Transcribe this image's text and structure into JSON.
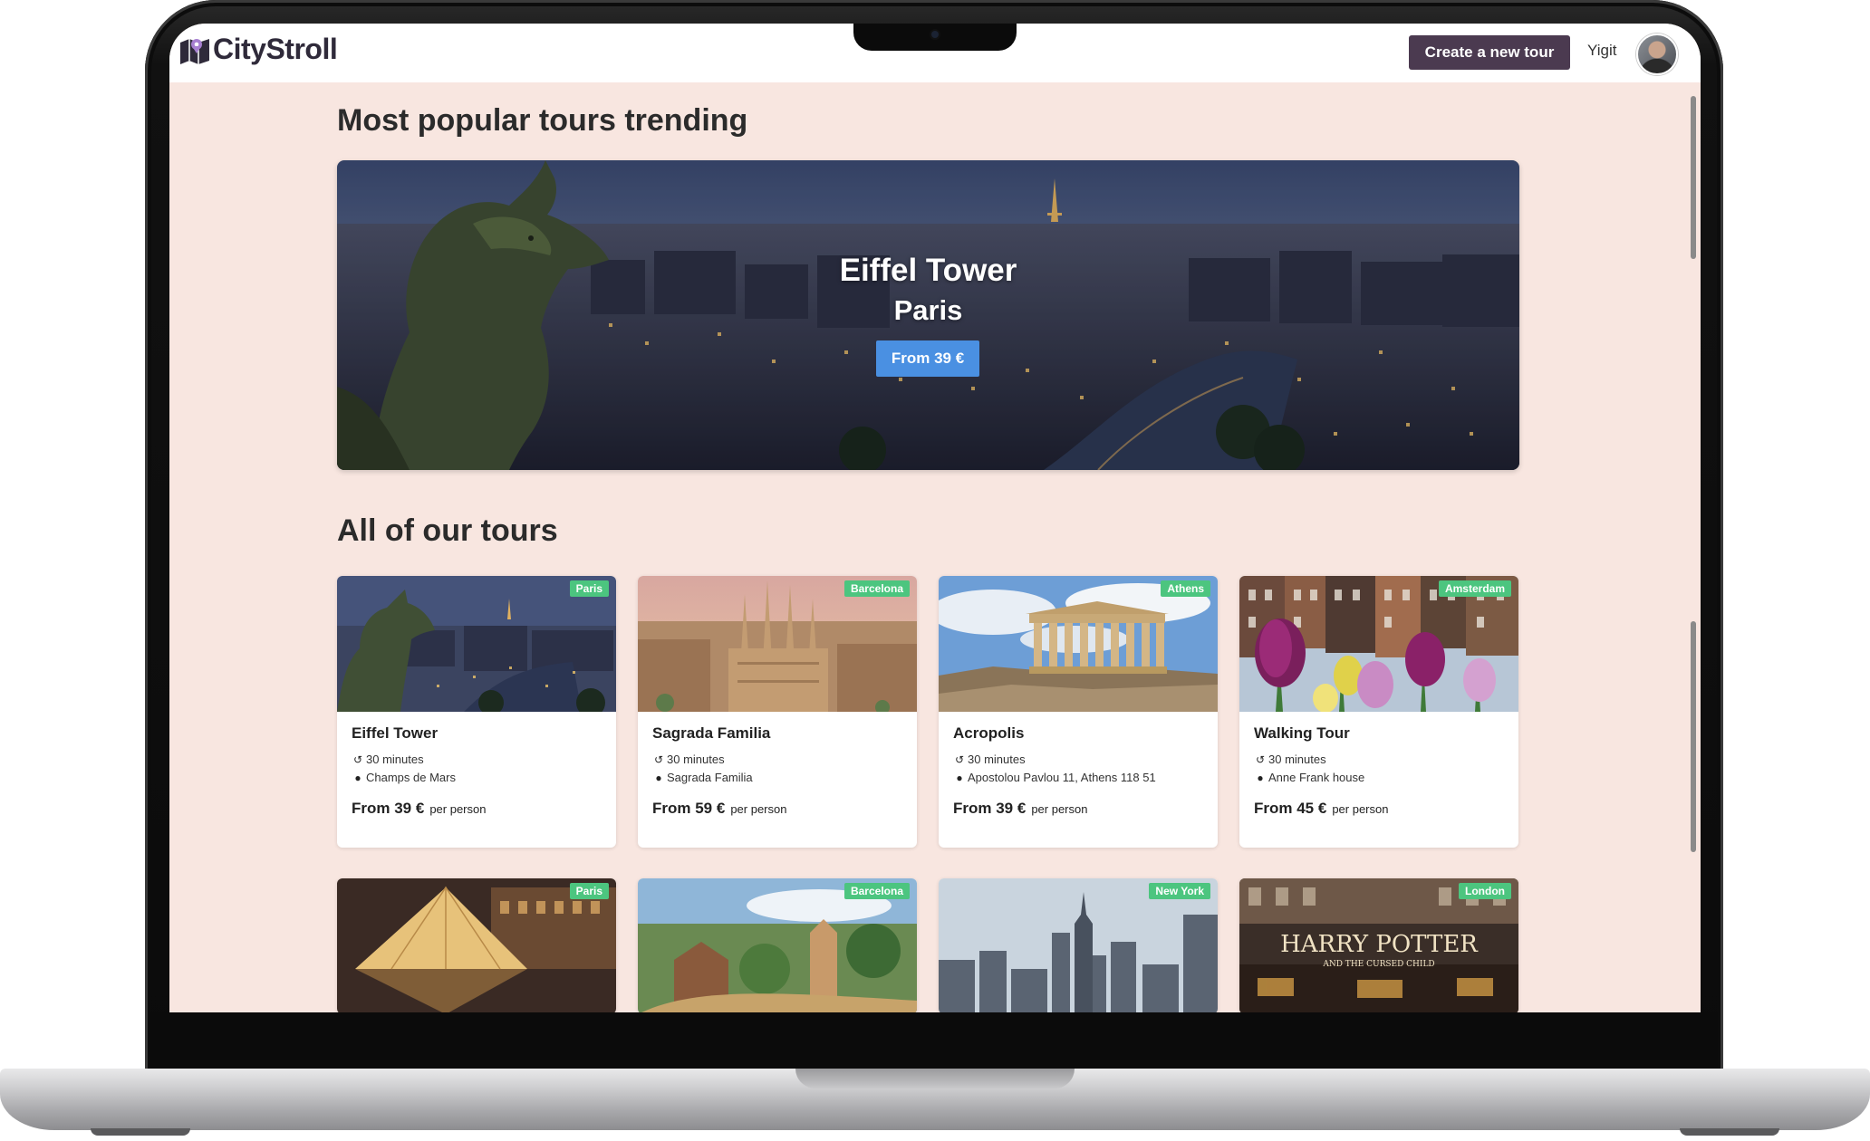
{
  "app": {
    "name": "CityStroll"
  },
  "header": {
    "create_button": "Create a new tour",
    "user_name": "Yigit"
  },
  "trending": {
    "title": "Most popular tours trending",
    "tour_name": "Eiffel Tower",
    "city": "Paris",
    "price": "From 39 €"
  },
  "all_tours": {
    "title": "All of our tours",
    "cards": [
      {
        "city": "Paris",
        "name": "Eiffel Tower",
        "duration": "30 minutes",
        "location": "Champs de Mars",
        "price": "From 39 €",
        "per": "per person"
      },
      {
        "city": "Barcelona",
        "name": "Sagrada Familia",
        "duration": "30 minutes",
        "location": "Sagrada Familia",
        "price": "From 59 €",
        "per": "per person"
      },
      {
        "city": "Athens",
        "name": "Acropolis",
        "duration": "30 minutes",
        "location": "Apostolou Pavlou 11, Athens 118 51",
        "price": "From 39 €",
        "per": "per person"
      },
      {
        "city": "Amsterdam",
        "name": "Walking Tour",
        "duration": "30 minutes",
        "location": "Anne Frank house",
        "price": "From 45 €",
        "per": "per person"
      },
      {
        "city": "Paris"
      },
      {
        "city": "Barcelona"
      },
      {
        "city": "New York"
      },
      {
        "city": "London",
        "poster_line1": "HARRY POTTER",
        "poster_line2": "AND THE CURSED CHILD"
      }
    ]
  },
  "colors": {
    "page_bg": "#f8e6e0",
    "brand_dark": "#4b3a50",
    "badge_green": "#4cc57f",
    "price_button_blue": "#4a90e2"
  },
  "icons": {
    "duration": "history-icon",
    "location": "map-marker-icon",
    "logo": "map-icon"
  }
}
